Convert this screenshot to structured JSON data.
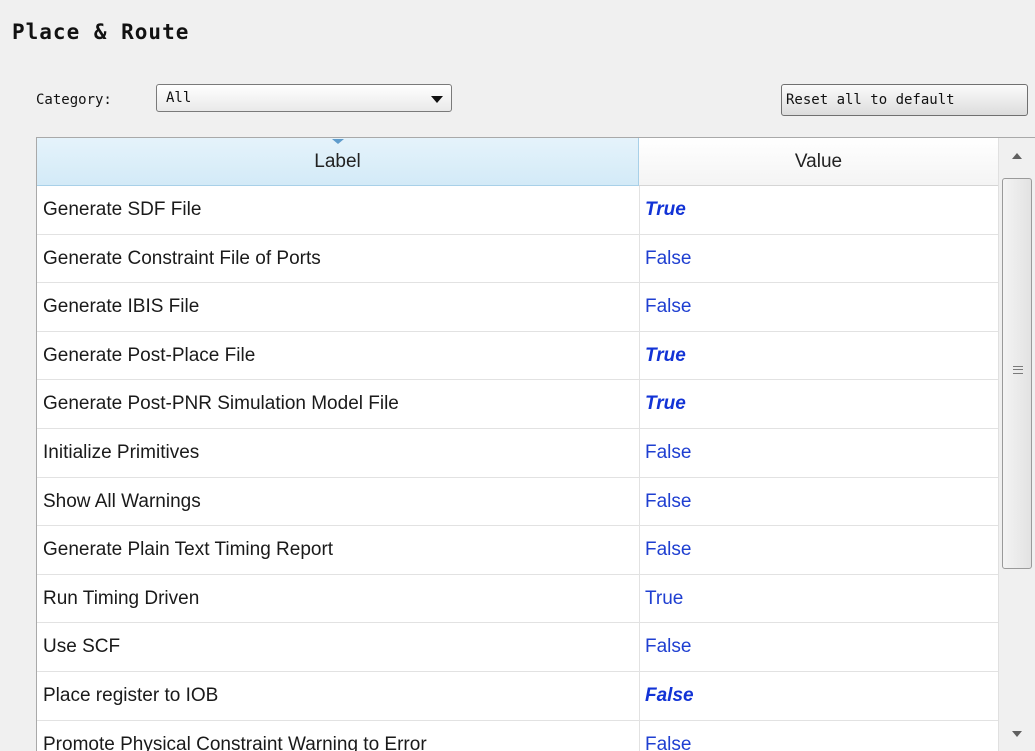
{
  "title": "Place & Route",
  "category": {
    "label": "Category:",
    "selected": "All"
  },
  "reset_button": "Reset all to default",
  "table": {
    "columns": {
      "label": "Label",
      "value": "Value"
    },
    "rows": [
      {
        "label": "Generate SDF File",
        "value": "True",
        "modified": true
      },
      {
        "label": "Generate Constraint File of Ports",
        "value": "False",
        "modified": false
      },
      {
        "label": "Generate IBIS File",
        "value": "False",
        "modified": false
      },
      {
        "label": "Generate Post-Place File",
        "value": "True",
        "modified": true
      },
      {
        "label": "Generate Post-PNR Simulation Model File",
        "value": "True",
        "modified": true
      },
      {
        "label": "Initialize Primitives",
        "value": "False",
        "modified": false
      },
      {
        "label": "Show All Warnings",
        "value": "False",
        "modified": false
      },
      {
        "label": "Generate Plain Text Timing Report",
        "value": "False",
        "modified": false
      },
      {
        "label": "Run Timing Driven",
        "value": "True",
        "modified": false
      },
      {
        "label": "Use SCF",
        "value": "False",
        "modified": false
      },
      {
        "label": "Place register to IOB",
        "value": "False",
        "modified": true
      },
      {
        "label": "Promote Physical Constraint Warning to Error",
        "value": "False",
        "modified": false
      }
    ]
  },
  "colors": {
    "value_text": "#1f3fd1",
    "header_selected": "#d3eaf7"
  }
}
